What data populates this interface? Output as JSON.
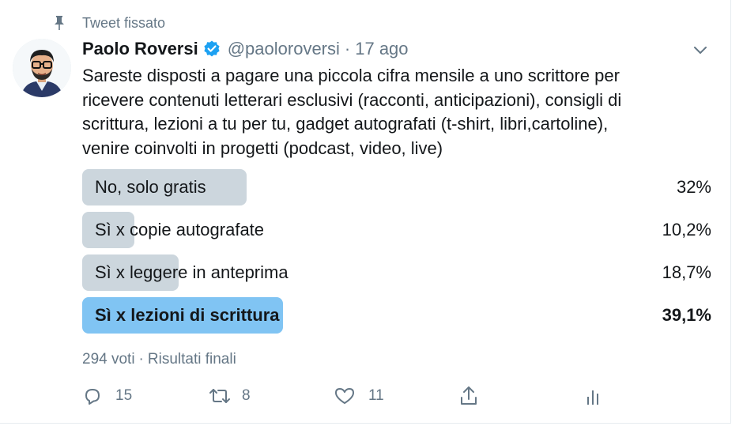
{
  "pinned": {
    "label": "Tweet fissato",
    "icon": "pin-icon"
  },
  "author": {
    "display_name": "Paolo Roversi",
    "verified": true,
    "handle": "@paoloroversi",
    "separator": "·",
    "date": "17 ago"
  },
  "tweet_text": [
    "Sareste disposti a pagare una piccola cifra mensile a uno scrittore per",
    "ricevere contenuti letterari esclusivi (racconti, anticipazioni), consigli di",
    "scrittura, lezioni a tu per tu, gadget autografati (t-shirt, libri,cartoline),",
    "venire coinvolti in progetti (podcast, video, live)"
  ],
  "poll": {
    "options": [
      {
        "label": "No, solo gratis",
        "percent_text": "32%",
        "percent": 32,
        "winner": false
      },
      {
        "label": "Sì x copie autografate",
        "percent_text": "10,2%",
        "percent": 10.2,
        "winner": false
      },
      {
        "label": "Sì x leggere in anteprima",
        "percent_text": "18,7%",
        "percent": 18.7,
        "winner": false
      },
      {
        "label": "Sì x lezioni di scrittura",
        "percent_text": "39,1%",
        "percent": 39.1,
        "winner": true
      }
    ],
    "votes": "294 voti",
    "separator": "·",
    "status": "Risultati finali"
  },
  "actions": {
    "reply_count": "15",
    "retweet_count": "8",
    "like_count": "11"
  },
  "colors": {
    "text": "#14171a",
    "secondary": "#657786",
    "poll_bar": "#ccd6dd",
    "poll_winner": "#80c4f3",
    "verified": "#1da1f2"
  }
}
